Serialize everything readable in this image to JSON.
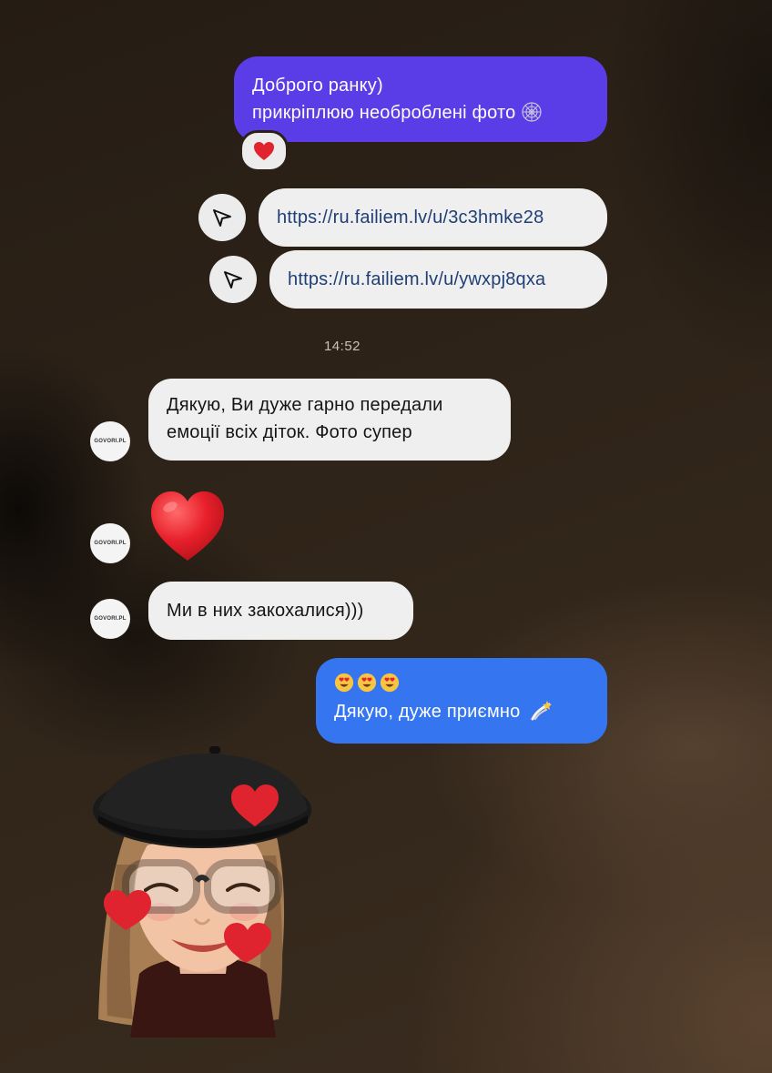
{
  "messages": {
    "out1_line1": "Доброго ранку)",
    "out1_line2": "прикріплюю необроблені фото",
    "out1_reaction": "heart-emoji",
    "link1": "https://ru.failiem.lv/u/3c3hmke28",
    "link2": "https://ru.failiem.lv/u/ywxpj8qxa",
    "timestamp": "14:52",
    "in1_line1": "Дякую, Ви дуже гарно передали",
    "in1_line2": "емоції всіх діток. Фото супер",
    "in2_text": "Ми в них закохалися)))",
    "out2_line2": "Дякую, дуже приємно"
  },
  "avatar": {
    "label": "GOVORI.PL"
  },
  "colors": {
    "outgoing_purple": "#5a3de6",
    "outgoing_blue": "#3576f0",
    "incoming_bg": "#efefef",
    "link_text": "#1f3f76",
    "heart_red": "#e0242f"
  },
  "icons": [
    "send-arrow-icon",
    "heart-emoji",
    "heart-eyes-emoji",
    "dizzy-emoji",
    "web-emoji",
    "memoji-sticker"
  ]
}
